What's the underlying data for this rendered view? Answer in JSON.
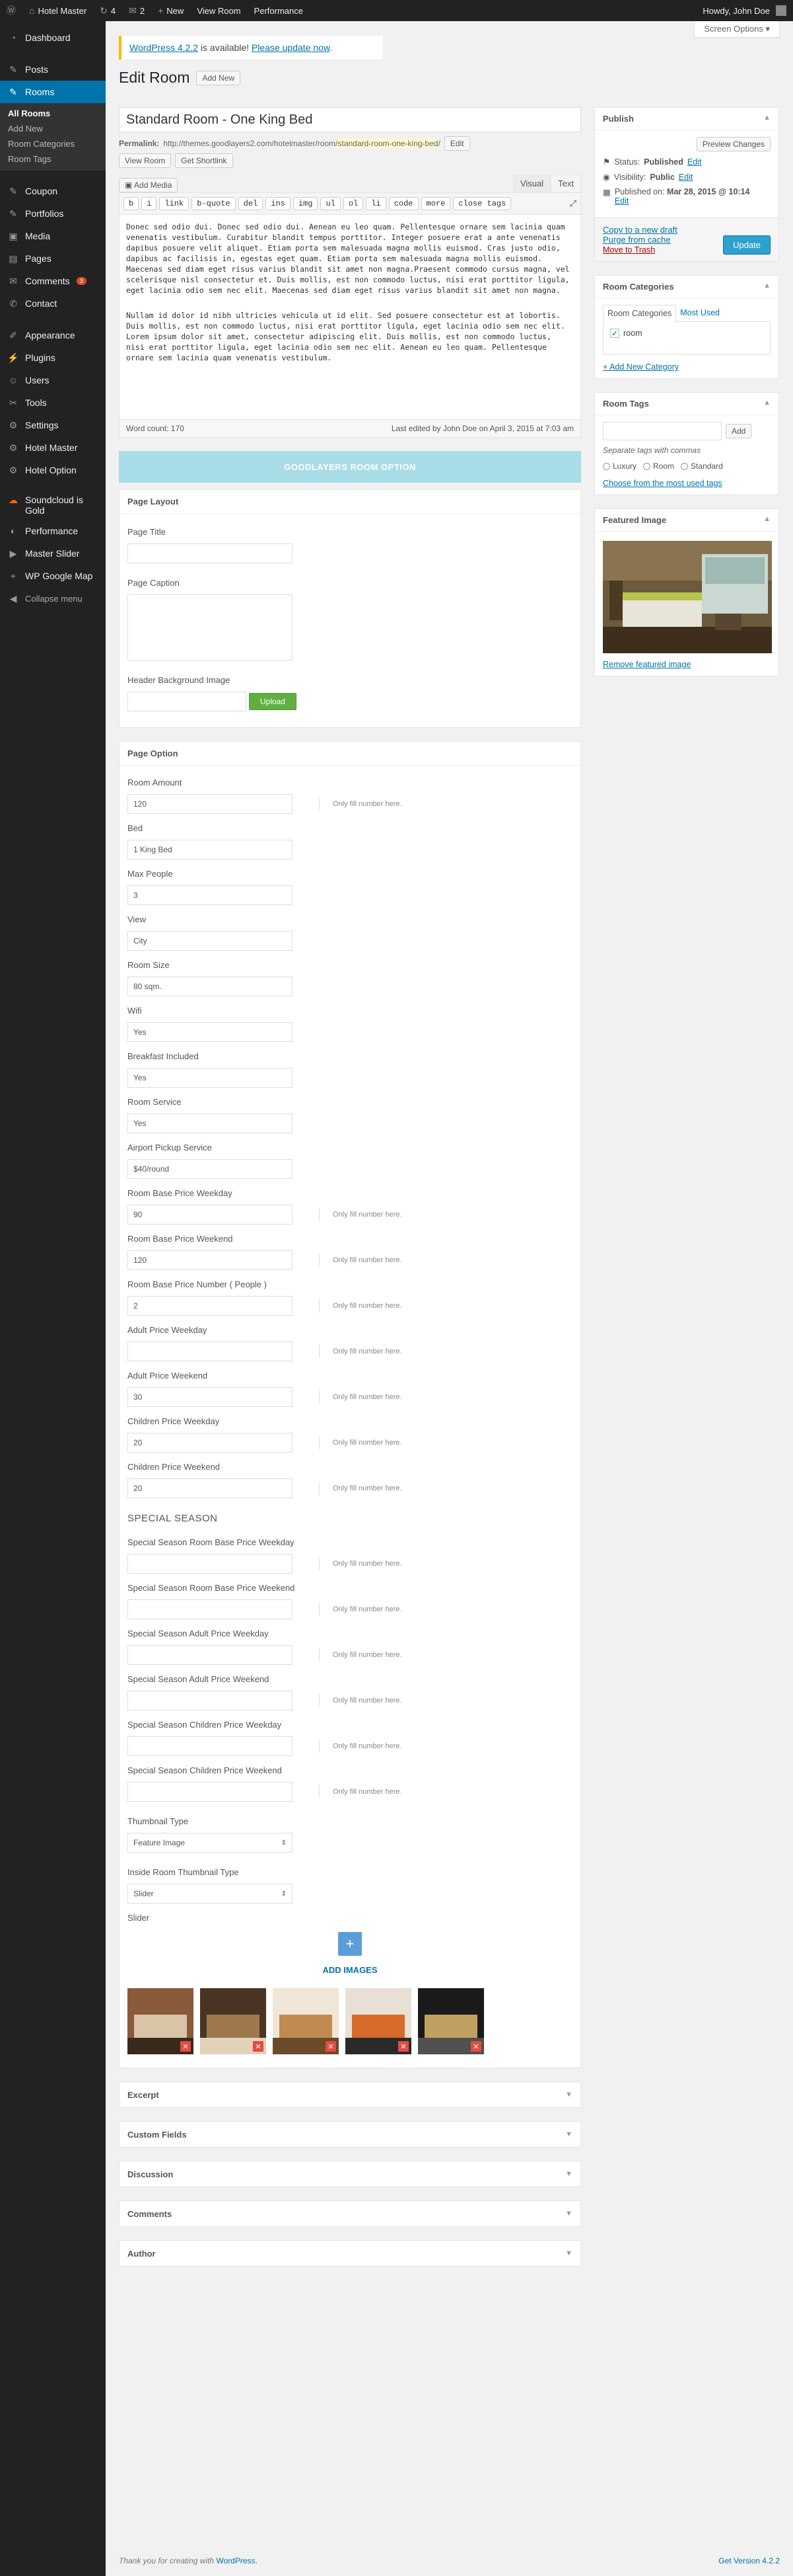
{
  "adminbar": {
    "site": "Hotel Master",
    "updates": "4",
    "comments": "2",
    "new": "New",
    "view": "View Room",
    "perf": "Performance",
    "howdy": "Howdy, John Doe"
  },
  "screen_options": "Screen Options ▾",
  "menu": {
    "dashboard": "Dashboard",
    "posts": "Posts",
    "rooms": "Rooms",
    "sub": [
      "All Rooms",
      "Add New",
      "Room Categories",
      "Room Tags"
    ],
    "coupon": "Coupon",
    "portfolios": "Portfolios",
    "media": "Media",
    "pages": "Pages",
    "comments": "Comments",
    "comments_badge": "3",
    "contact": "Contact",
    "appearance": "Appearance",
    "plugins": "Plugins",
    "users": "Users",
    "tools": "Tools",
    "settings": "Settings",
    "hotel_master": "Hotel Master",
    "hotel_option": "Hotel Option",
    "soundcloud": "Soundcloud is Gold",
    "performance": "Performance",
    "master_slider": "Master Slider",
    "wp_google_map": "WP Google Map",
    "collapse": "Collapse menu"
  },
  "notice": {
    "link1": "WordPress 4.2.2",
    "text": " is available! ",
    "link2": "Please update now",
    "end": "."
  },
  "page": {
    "heading": "Edit Room",
    "add_new": "Add New"
  },
  "post": {
    "title": "Standard Room - One King Bed",
    "permalink_label": "Permalink:",
    "permalink_base": "http://themes.goodlayers2.com/hotelmaster/room/",
    "permalink_slug": "standard-room-one-king-bed",
    "permalink_end": "/",
    "edit": "Edit",
    "view_post": "View Room",
    "shortlink": "Get Shortlink"
  },
  "editor": {
    "add_media": "Add Media",
    "visual": "Visual",
    "text": "Text",
    "quicktags": [
      "b",
      "i",
      "link",
      "b-quote",
      "del",
      "ins",
      "img",
      "ul",
      "ol",
      "li",
      "code",
      "more",
      "close tags"
    ],
    "p1": "Donec sed odio dui. Donec sed odio dui. Aenean eu leo quam. Pellentesque ornare sem lacinia quam venenatis vestibulum. Curabitur blandit tempus porttitor. Integer posuere erat a ante venenatis dapibus posuere velit aliquet. Etiam porta sem malesuada magna mollis euismod. Cras justo odio, dapibus ac facilisis in, egestas eget quam. Etiam porta sem malesuada magna mollis euismod. Maecenas sed diam eget risus varius blandit sit amet non magna.Praesent commodo cursus magna, vel scelerisque nisl consectetur et. Duis mollis, est non commodo luctus, nisi erat porttitor ligula, eget lacinia odio sem nec elit. Maecenas sed diam eget risus varius blandit sit amet non magna.",
    "p2": "Nullam id dolor id nibh ultricies vehicula ut id elit. Sed posuere consectetur est at lobortis. Duis mollis, est non commodo luctus, nisi erat porttitor ligula, eget lacinia odio sem nec elit. Lorem ipsum dolor sit amet, consectetur adipiscing elit. Duis mollis, est non commodo luctus, nisi erat porttitor ligula, eget lacinia odio sem nec elit. Aenean eu leo quam. Pellentesque ornare sem lacinia quam venenatis vestibulum.",
    "word_count": "Word count: 170",
    "last_edited": "Last edited by John Doe on April 3, 2015 at 7:03 am"
  },
  "goodlayers": "GOODLAYERS ROOM OPTION",
  "layout": {
    "title": "Page Layout",
    "page_title": "Page Title",
    "page_caption": "Page Caption",
    "header_bg": "Header Background Image",
    "upload": "Upload"
  },
  "option": {
    "title": "Page Option",
    "note": "Only fill number here.",
    "fields": [
      {
        "label": "Room Amount",
        "value": "120",
        "note": true
      },
      {
        "label": "Bed",
        "value": "1 King Bed",
        "note": false
      },
      {
        "label": "Max People",
        "value": "3",
        "note": false
      },
      {
        "label": "View",
        "value": "City",
        "note": false
      },
      {
        "label": "Room Size",
        "value": "80 sqm.",
        "note": false
      },
      {
        "label": "Wifi",
        "value": "Yes",
        "note": false
      },
      {
        "label": "Breakfast Included",
        "value": "Yes",
        "note": false
      },
      {
        "label": "Room Service",
        "value": "Yes",
        "note": false
      },
      {
        "label": "Airport Pickup Service",
        "value": "$40/round",
        "note": false
      },
      {
        "label": "Room Base Price Weekday",
        "value": "90",
        "note": true
      },
      {
        "label": "Room Base Price Weekend",
        "value": "120",
        "note": true
      },
      {
        "label": "Room Base Price Number ( People )",
        "value": "2",
        "note": true
      },
      {
        "label": "Adult Price Weekday",
        "value": "",
        "note": true
      },
      {
        "label": "Adult Price Weekend",
        "value": "30",
        "note": true
      },
      {
        "label": "Children Price Weekday",
        "value": "20",
        "note": true
      },
      {
        "label": "Children Price Weekend",
        "value": "20",
        "note": true
      }
    ],
    "special": "SPECIAL SEASON",
    "special_fields": [
      "Special Season Room Base Price Weekday",
      "Special Season Room Base Price Weekend",
      "Special Season Adult Price Weekday",
      "Special Season Adult Price Weekend",
      "Special Season Children Price Weekday",
      "Special Season Children Price Weekend"
    ],
    "thumb_type": "Thumbnail Type",
    "thumb_value": "Feature Image",
    "inside_type": "Inside Room Thumbnail Type",
    "inside_value": "Slider",
    "slider": "Slider",
    "add_images": "ADD IMAGES"
  },
  "boxes": [
    "Excerpt",
    "Custom Fields",
    "Discussion",
    "Comments",
    "Author"
  ],
  "publish": {
    "title": "Publish",
    "preview": "Preview Changes",
    "status_label": "Status: ",
    "status": "Published",
    "visibility_label": "Visibility: ",
    "visibility": "Public",
    "published_label": "Published on: ",
    "published": "Mar 28, 2015 @ 10:14",
    "edit": "Edit",
    "copy": "Copy to a new draft",
    "purge": "Purge from cache",
    "trash": "Move to Trash",
    "update": "Update"
  },
  "categories": {
    "title": "Room Categories",
    "tab1": "Room Categories",
    "tab2": "Most Used",
    "item": "room",
    "add": "+ Add New Category"
  },
  "tags": {
    "title": "Room Tags",
    "add": "Add",
    "hint": "Separate tags with commas",
    "tags": [
      "Luxury",
      "Room",
      "Standard"
    ],
    "choose": "Choose from the most used tags"
  },
  "featured": {
    "title": "Featured Image",
    "remove": "Remove featured image"
  },
  "footer": {
    "thanks": "Thank you for creating with ",
    "wp": "WordPress.",
    "version": "Get Version 4.2.2"
  },
  "colors": {
    "accent": "#0073aa",
    "admin_bg": "#222222",
    "goodlayers": "#a8dce6",
    "upload": "#5fb041",
    "update": "#2ea2cc"
  }
}
